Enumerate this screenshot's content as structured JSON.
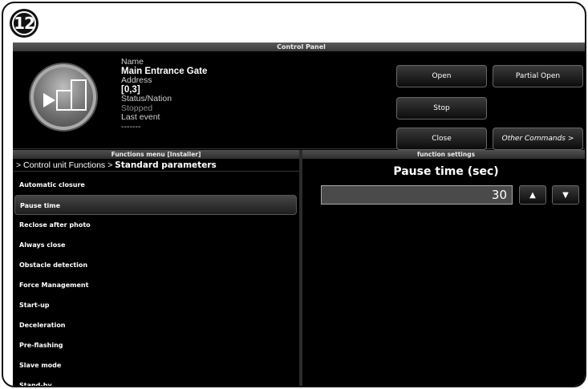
{
  "step": "12",
  "window": {
    "title": "Control Panel"
  },
  "device": {
    "name_label": "Name",
    "name_value": "Main Entrance Gate",
    "address_label": "Address",
    "address_value": "[0,3]",
    "status_label": "Status/Nation",
    "status_value": "Stopped",
    "event_label": "Last event",
    "event_value": "-------"
  },
  "commands": {
    "open": "Open",
    "partial_open": "Partial Open",
    "stop": "Stop",
    "close": "Close",
    "other": "Other Commands >"
  },
  "functions_menu": {
    "header": "Functions menu [Installer]",
    "breadcrumb_prefix": "> Control unit Functions > ",
    "breadcrumb_current": "Standard parameters",
    "items": [
      "Automatic closure",
      "Pause time",
      "Reclose after photo",
      "Always close",
      "Obstacle detection",
      "Force Management",
      "Start-up",
      "Deceleration",
      "Pre-flashing",
      "Slave mode",
      "Stand-by"
    ],
    "selected_index": 1
  },
  "function_settings": {
    "header": "function settings",
    "title": "Pause time  (sec)",
    "value": "30",
    "up_symbol": "▲",
    "down_symbol": "▼"
  }
}
